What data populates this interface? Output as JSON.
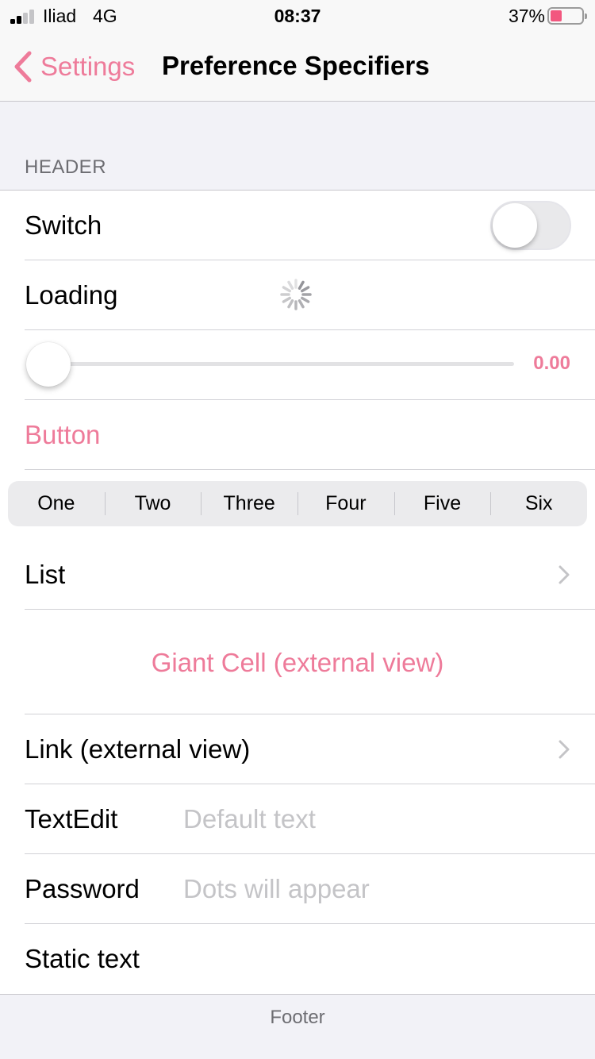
{
  "status_bar": {
    "carrier": "Iliad",
    "network": "4G",
    "time": "08:37",
    "battery_percent": "37%",
    "battery_level": 0.37,
    "signal_bars_filled": 2,
    "signal_bars_total": 4
  },
  "nav": {
    "back_label": "Settings",
    "title": "Preference Specifiers"
  },
  "section": {
    "header": "HEADER",
    "footer": "Footer"
  },
  "rows": {
    "switch": {
      "label": "Switch",
      "on": false
    },
    "loading": {
      "label": "Loading"
    },
    "slider": {
      "value": 0.0,
      "value_text": "0.00"
    },
    "button": {
      "label": "Button"
    },
    "segments": [
      "One",
      "Two",
      "Three",
      "Four",
      "Five",
      "Six"
    ],
    "list": {
      "label": "List"
    },
    "giant_cell": {
      "label": "Giant Cell (external view)"
    },
    "link": {
      "label": "Link (external view)"
    },
    "text_edit": {
      "label": "TextEdit",
      "placeholder": "Default text",
      "value": ""
    },
    "password": {
      "label": "Password",
      "placeholder": "Dots will appear",
      "value": ""
    },
    "static_text": {
      "label": "Static text"
    }
  },
  "colors": {
    "accent": "#ee7b9a",
    "label": "#000000",
    "secondary": "#6d6d72",
    "placeholder": "#c4c4c7",
    "separator": "#d1d1d6",
    "grouped_bg": "#f2f2f7",
    "battery_low": "#f2577f"
  },
  "icons": {
    "back": "chevron-left-icon",
    "disclosure": "chevron-right-icon",
    "spinner": "activity-indicator-icon",
    "signal": "cellular-signal-icon",
    "battery": "battery-icon"
  }
}
